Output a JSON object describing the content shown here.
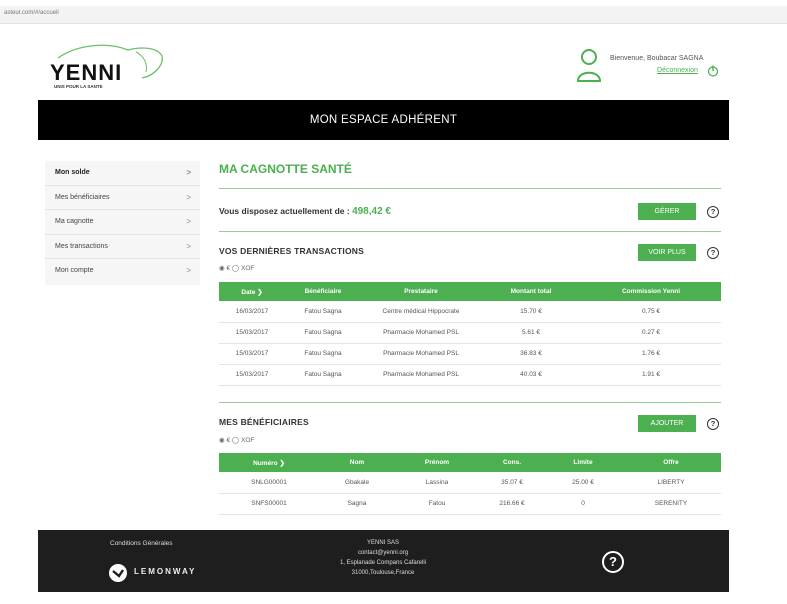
{
  "browser": {
    "url": "asteur.com/#/accueil"
  },
  "logo": {
    "name": "YENNI",
    "tagline": "UNIS POUR LA SANTE"
  },
  "user": {
    "welcome": "Bienvenue, Boubacar SAGNA",
    "logout": "Déconnexion"
  },
  "banner": {
    "title": "MON ESPACE ADHÉRENT"
  },
  "sidebar": {
    "items": [
      {
        "label": "Mon solde",
        "chevron": ">"
      },
      {
        "label": "Mes bénéficiaires",
        "chevron": ">"
      },
      {
        "label": "Ma cagnotte",
        "chevron": ">"
      },
      {
        "label": "Mes transactions",
        "chevron": ">"
      },
      {
        "label": "Mon compte",
        "chevron": ">"
      }
    ]
  },
  "main": {
    "title": "MA CAGNOTTE SANTÉ",
    "balance_label": "Vous disposez actuellement de :",
    "balance_value": "498,42 €",
    "manage_button": "GÉRER",
    "help_symbol": "?"
  },
  "transactions": {
    "title": "VOS DERNIÈRES TRANSACTIONS",
    "more_button": "VOIR PLUS",
    "currency_toggle": "◉ € ◯ XOF",
    "headers": [
      "Date ❯",
      "Bénéficiaire",
      "Prestataire",
      "Montant total",
      "Commission Yenni"
    ],
    "rows": [
      [
        "16/03/2017",
        "Fatou Sagna",
        "Centre médical Hippocrate",
        "15.70 €",
        "0.75 €"
      ],
      [
        "15/03/2017",
        "Fatou Sagna",
        "Pharmacie Mohamed PSL",
        "5.61 €",
        "0.27 €"
      ],
      [
        "15/03/2017",
        "Fatou Sagna",
        "Pharmacie Mohamed PSL",
        "36.83 €",
        "1.76 €"
      ],
      [
        "15/03/2017",
        "Fatou Sagna",
        "Pharmacie Mohamed PSL",
        "40.03 €",
        "1.91 €"
      ]
    ]
  },
  "beneficiaries": {
    "title": "MES BÉNÉFICIAIRES",
    "add_button": "AJOUTER",
    "currency_toggle": "◉ € ◯ XOF",
    "headers": [
      "Numéro ❯",
      "Nom",
      "Prénom",
      "Cons.",
      "Limite",
      "Offre"
    ],
    "rows": [
      [
        "SNLG00001",
        "Gbakale",
        "Lassina",
        "35.07 €",
        "25.00 €",
        "LIBERTY"
      ],
      [
        "SNFS00001",
        "Sagna",
        "Fatou",
        "216.66 €",
        "0",
        "SERENITY"
      ]
    ]
  },
  "footer": {
    "conditions": "Conditions Générales",
    "payment_brand": "LEMONWAY",
    "company_lines": [
      "YENNI SAS",
      "contact@yenni.org",
      "1, Esplanade Compans Cafarelli",
      "31000,Toulouse,France"
    ]
  },
  "colors": {
    "accent": "#4caf50",
    "banner": "#000000",
    "footer": "#1e1e1e"
  }
}
